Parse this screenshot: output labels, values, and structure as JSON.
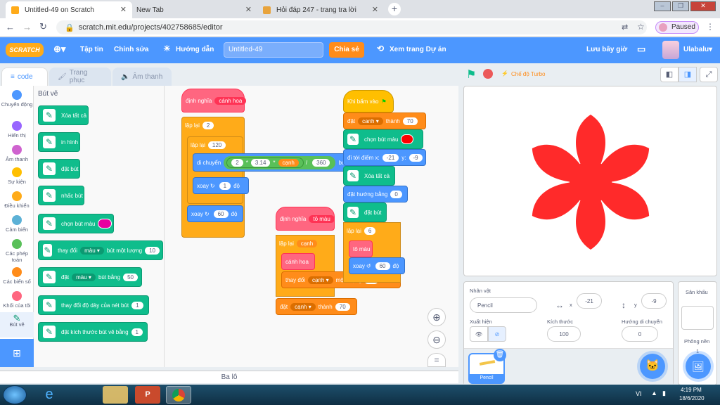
{
  "browser": {
    "tabs": [
      {
        "title": "Untitled-49 on Scratch"
      },
      {
        "title": "New Tab"
      },
      {
        "title": "Hỏi đáp 247 - trang tra lời"
      }
    ],
    "url": "scratch.mit.edu/projects/402758685/editor",
    "paused_label": "Paused"
  },
  "menu": {
    "logo": "SCRATCH",
    "file": "Tập tin",
    "edit": "Chỉnh sửa",
    "tutorial": "Hướng dẫn",
    "project_title": "Untitled-49",
    "share": "Chia sẻ",
    "see_project": "Xem trang Dự án",
    "save_now": "Lưu bây giờ",
    "username": "Ulabalu"
  },
  "editor_tabs": {
    "code": "code",
    "costumes": "Trang phục",
    "sounds": "Âm thanh"
  },
  "categories": [
    {
      "label": "Chuyển động",
      "color": "#4c97ff"
    },
    {
      "label": "Hiển thị",
      "color": "#9966ff"
    },
    {
      "label": "Âm thanh",
      "color": "#cf63cf"
    },
    {
      "label": "Sự kiện",
      "color": "#ffbf00"
    },
    {
      "label": "Điều khiển",
      "color": "#ffab19"
    },
    {
      "label": "Cảm biến",
      "color": "#5cb1d6"
    },
    {
      "label": "Các phép toán",
      "color": "#59c059"
    },
    {
      "label": "Các biến số",
      "color": "#ff8c1a"
    },
    {
      "label": "Khối của tôi",
      "color": "#ff6680"
    },
    {
      "label": "Bút vẽ",
      "color": "#0fbd8c"
    }
  ],
  "palette": {
    "header": "Bút vẽ",
    "blocks": [
      "Xóa tất cả",
      "in hình",
      "đặt bút",
      "nhấc bút",
      "chọn bút màu",
      "thay đổi",
      "màu",
      "bút một lượng",
      "10",
      "đặt",
      "màu",
      "bút bằng",
      "50",
      "thay đổi độ dày của nét bút",
      "1",
      "đặt kích thước bút vẽ bằng",
      "1"
    ]
  },
  "script1": {
    "define": "định nghĩa",
    "name": "cánh hoa",
    "repeat": "lặp lại",
    "n2": "2",
    "repeat2": "lặp lại",
    "n120": "120",
    "move": "di chuyển",
    "v2": "2",
    "op_mul": "*",
    "v314": "3.14",
    "op_mul2": "*",
    "var_canh": "cạnh",
    "op_div": "/",
    "v360": "360",
    "steps": "bước",
    "turn": "xoay",
    "v1": "1",
    "deg": "độ",
    "turn2": "xoay",
    "v60": "60",
    "deg2": "độ"
  },
  "script2": {
    "define": "định nghĩa",
    "name": "tô màu",
    "repeat": "lặp lại",
    "var_canh": "cạnh",
    "call": "cánh hoa",
    "change": "thay đổi",
    "var_canh2": "cạnh",
    "by": "một lượng",
    "vminus1": "-1",
    "set": "đặt",
    "var_canh3": "cạnh",
    "to": "thành",
    "v70": "70"
  },
  "script3": {
    "when_flag": "Khi bấm vào",
    "set": "đặt",
    "var": "canh",
    "to": "thành",
    "v70": "70",
    "pen_color": "chọn bút màu",
    "goto": "đi tới điểm x:",
    "x": "-21",
    "y_label": "y:",
    "y": "-9",
    "clear": "Xóa tất cả",
    "point": "đặt hướng bằng",
    "dir": "0",
    "pen_down": "đặt bút",
    "repeat": "lặp lại",
    "n6": "6",
    "call": "tô màu",
    "turn": "xoay",
    "v60": "60",
    "deg": "độ"
  },
  "stage_header": {
    "turbo": "Chế độ Turbo"
  },
  "sprite_panel": {
    "sprite_label": "Nhân vật",
    "sprite_name": "Pencil",
    "x_label": "x",
    "x": "-21",
    "y_label": "y",
    "y": "-9",
    "show_label": "Xuất hiện",
    "size_label": "Kích thước",
    "size": "100",
    "direction_label": "Hướng di chuyển",
    "direction": "0",
    "thumb_label": "Pencil"
  },
  "stage_panel": {
    "title": "Sân khấu",
    "backdrops_label": "Phông nền",
    "backdrops_count": "1"
  },
  "backpack": "Ba lô",
  "taskbar": {
    "lang": "VI",
    "time": "4:19 PM",
    "date": "18/6/2020"
  },
  "colors": {
    "flower": "#ff2a2a",
    "scratch_blue": "#4c97ff"
  }
}
